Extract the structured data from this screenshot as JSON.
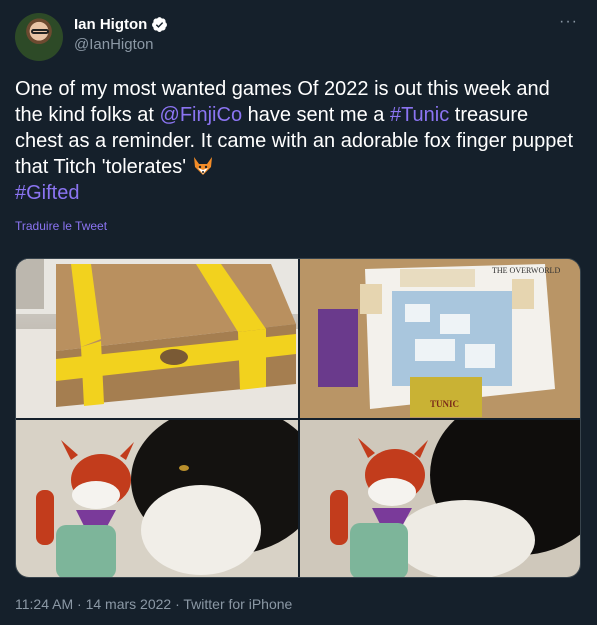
{
  "author": {
    "display_name": "Ian Higton",
    "handle": "@IanHigton"
  },
  "tweet": {
    "seg1": "One of my most wanted games Of 2022 is out this week and the kind folks at ",
    "mention": "@FinjiCo",
    "seg2": " have sent me a ",
    "hashtag1": "#Tunic",
    "seg3": " treasure chest as a reminder. It came with an adorable fox finger puppet that Titch 'tolerates' ",
    "hashtag2": "#Gifted"
  },
  "translate_label": "Traduire le Tweet",
  "media": {
    "map_label": "THE OVERWORLD",
    "box_label": "TUNIC"
  },
  "meta": {
    "time": "11:24 AM",
    "sep1": " · ",
    "date": "14 mars 2022",
    "sep2": " · ",
    "source": "Twitter for iPhone"
  },
  "colors": {
    "background": "#15202b",
    "accent": "#8b74f2",
    "muted": "#8b98a5",
    "verified": "#ffffff"
  },
  "icons": [
    "verified-badge-icon",
    "more-options-icon",
    "fox-emoji-icon"
  ]
}
